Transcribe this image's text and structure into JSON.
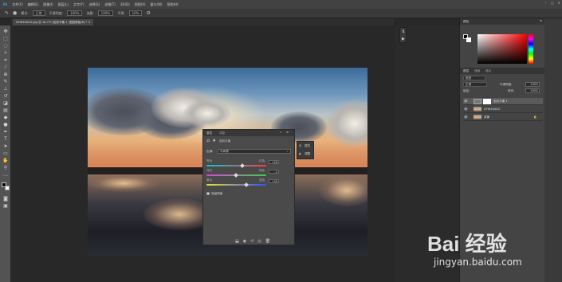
{
  "menu": {
    "items": [
      "文件(F)",
      "编辑(E)",
      "图像(I)",
      "图层(L)",
      "文字(Y)",
      "选择(S)",
      "滤镜(T)",
      "3D(D)",
      "视图(V)",
      "窗口(W)",
      "帮助(H)"
    ]
  },
  "options": {
    "items": [
      "模式:",
      "正常",
      "不透明度:",
      "100%",
      "流量:",
      "100%",
      "平滑:",
      "10%"
    ]
  },
  "doc_tab": {
    "label": "DYW4VA4G.jpg @ 16.7% (色彩平衡 1, 图层蒙版/8) *"
  },
  "properties": {
    "tabs": [
      "属性",
      "调整"
    ],
    "title": "色彩平衡",
    "tone_label": "色调:",
    "tone_value": "中间调",
    "sliders": [
      {
        "left": "青色",
        "right": "红色",
        "value": "+26",
        "pos": 0.6
      },
      {
        "left": "洋红",
        "right": "绿色",
        "value": "-2",
        "pos": 0.49
      },
      {
        "left": "黄色",
        "right": "蓝色",
        "value": "+39",
        "pos": 0.66
      }
    ],
    "preserve": "保留明度"
  },
  "minipanel": {
    "items": [
      "属性",
      "调整"
    ]
  },
  "color_panel": {
    "title": "颜色"
  },
  "layers_panel": {
    "tabs": [
      "图层",
      "通道",
      "路径"
    ],
    "kind": "类型",
    "blend": "正常",
    "opacity_label": "不透明度:",
    "opacity": "100%",
    "lock_label": "锁定:",
    "fill_label": "填充:",
    "fill": "100%",
    "layers": [
      {
        "name": "色彩平衡 1",
        "selected": true
      },
      {
        "name": "DYW4VA4G",
        "selected": false
      },
      {
        "name": "背景",
        "selected": false
      }
    ]
  },
  "watermark": {
    "brand": "Bai 经验",
    "url": "jingyan.baidu.com"
  }
}
